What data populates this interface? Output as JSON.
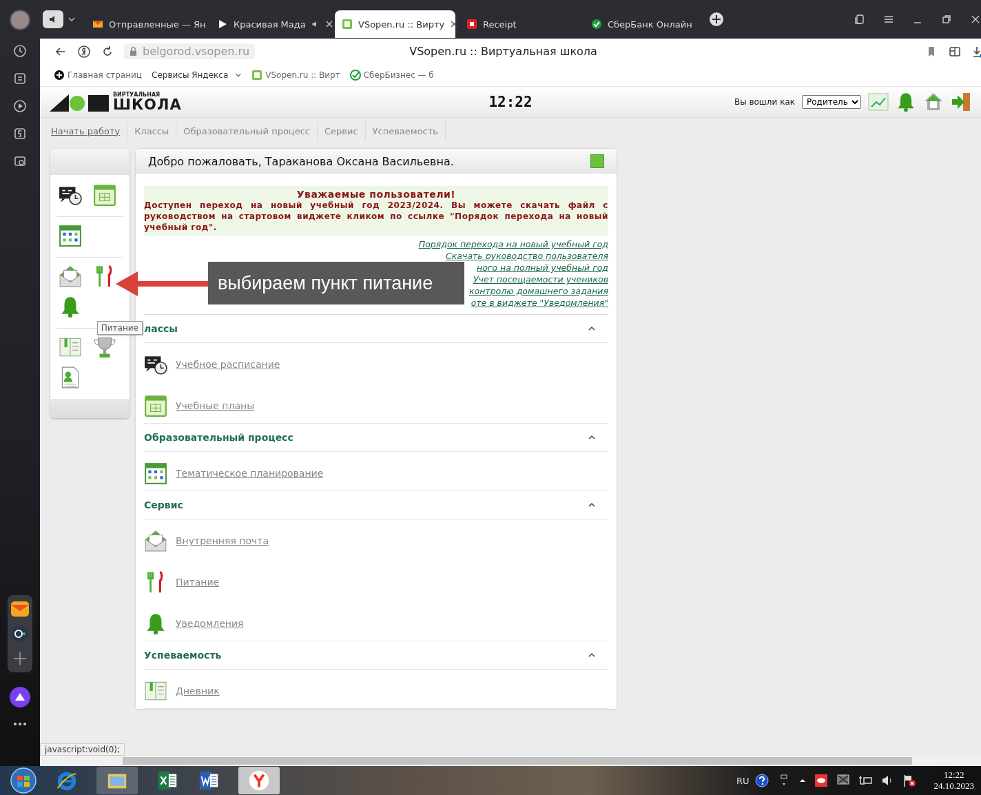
{
  "browser": {
    "tabs": [
      {
        "label": "Отправленные — Ян",
        "kind": "mail",
        "selected": false
      },
      {
        "label": "Красивая Мада",
        "kind": "video",
        "selected": false
      },
      {
        "label": "VSopen.ru :: Вирту",
        "kind": "site",
        "selected": true
      },
      {
        "label": "Receipt",
        "kind": "receipt",
        "selected": false
      },
      {
        "label": "СберБанк Онлайн",
        "kind": "sber",
        "selected": false
      }
    ],
    "url": "belgorod.vsopen.ru",
    "page_title": "VSopen.ru :: Виртуальная школа",
    "bookmarks": [
      {
        "label": "Главная страниц",
        "kind": "home"
      },
      {
        "label": "Сервисы Яндекса",
        "kind": "menu"
      },
      {
        "label": "VSopen.ru :: Вирт",
        "kind": "site"
      },
      {
        "label": "СберБизнес — б",
        "kind": "sber"
      }
    ],
    "status_text": "javascript:void(0);"
  },
  "site": {
    "logo": {
      "caption": "ВИРТУАЛЬНАЯ",
      "name": "ШКОЛА"
    },
    "clock": "12:22",
    "login_label": "Вы вошли как",
    "role": "Родитель",
    "nav": [
      {
        "label": "Начать работу",
        "selected": true
      },
      {
        "label": "Классы",
        "selected": false
      },
      {
        "label": "Образовательный процесс",
        "selected": false
      },
      {
        "label": "Сервис",
        "selected": false
      },
      {
        "label": "Успеваемость",
        "selected": false
      }
    ],
    "welcome": "Добро пожаловать, Тараканова Оксана Васильевна.",
    "notice": {
      "title": "Уважаемые пользователи!",
      "text": "Доступен переход на новый учебный год 2023/2024. Вы можете скачать файл с руководством на стартовом виджете кликом по ссылке \"Порядок перехода на новый учебный год\"."
    },
    "links": [
      "Порядок перехода на новый учебный год",
      "Скачать руководство пользователя",
      "ного на полный учебный год",
      "Учет посещаемости учеников",
      "контролю домашнего задания",
      "оте в виджете \"Уведомления\""
    ],
    "tooltip": "Питание",
    "sections": [
      {
        "title": "лассы",
        "expanded": true,
        "items": [
          {
            "label": "Учебное расписание",
            "kind": "schedule"
          },
          {
            "label": "Учебные планы",
            "kind": "calendar"
          }
        ]
      },
      {
        "title": "Образовательный процесс",
        "expanded": true,
        "items": [
          {
            "label": "Тематическое планирование",
            "kind": "planner"
          }
        ]
      },
      {
        "title": "Сервис",
        "expanded": true,
        "items": [
          {
            "label": "Внутренняя почта",
            "kind": "mail"
          },
          {
            "label": "Питание",
            "kind": "food"
          },
          {
            "label": "Уведомления",
            "kind": "bell"
          }
        ]
      },
      {
        "title": "Успеваемость",
        "expanded": true,
        "items": [
          {
            "label": "Дневник",
            "kind": "diary"
          }
        ]
      }
    ]
  },
  "annotation": {
    "text": "выбираем пункт питание"
  },
  "taskbar": {
    "language": "RU",
    "time": "12:22",
    "date": "24.10.2023"
  }
}
